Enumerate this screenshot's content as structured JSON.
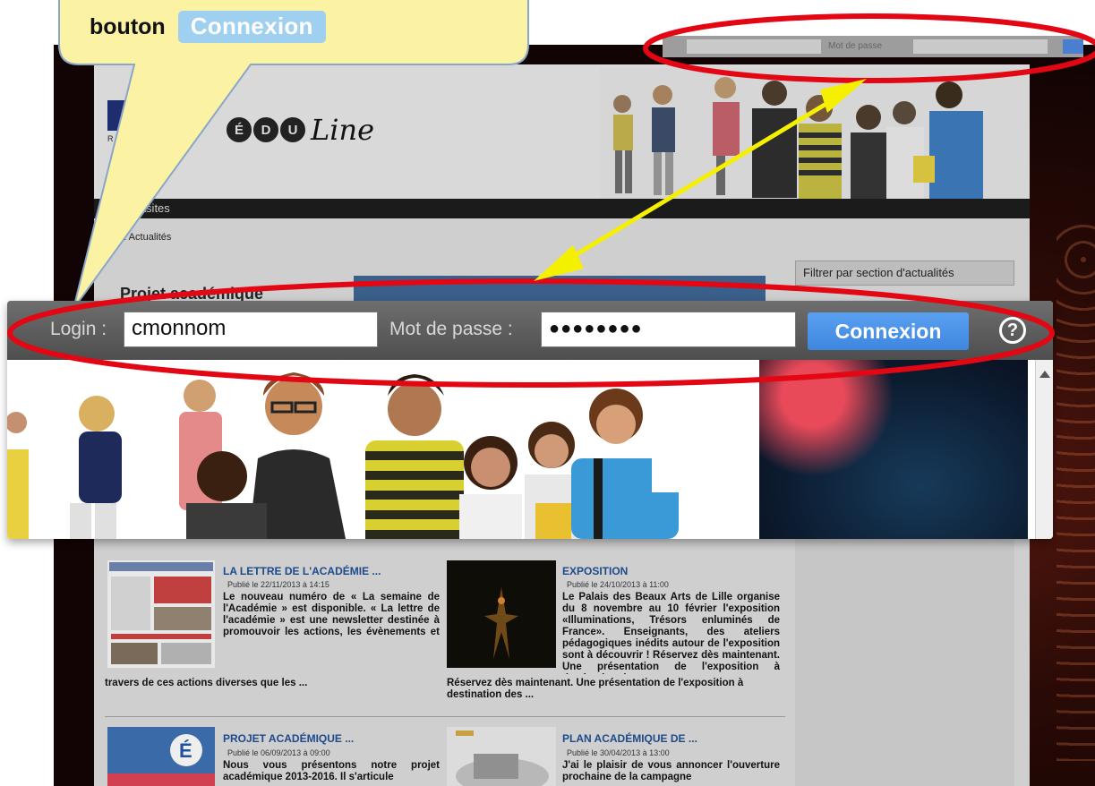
{
  "callout": {
    "word": "bouton",
    "button_chip": "Connexion"
  },
  "mini_login": {
    "password_placeholder": "Mot de passe"
  },
  "site": {
    "logo_letters": [
      "É",
      "D",
      "U"
    ],
    "logo_script": "Line",
    "nav_item": "masites",
    "breadcrumb": "line : Actualités",
    "filter_title": "Filtrer par section d'actualités",
    "featured_title": "Projet académique"
  },
  "login_bar": {
    "login_label": "Login :",
    "login_value": "cmonnom",
    "password_label": "Mot de passe :",
    "password_value": "●●●●●●●●",
    "submit_label": "Connexion",
    "help_label": "?"
  },
  "news": [
    {
      "title": "LA LETTRE DE L'ACADÉMIE ...",
      "date": "Publié le 22/11/2013 à 14:15",
      "body": "Le nouveau numéro de « La semaine de l'Académie » est disponible. « La lettre de l'académie » est une newsletter destinée à promouvoir les actions, les évènements et les projets se déroulant au sein des établissements. C'est au travers de ces actions diverses que les ..."
    },
    {
      "title": "EXPOSITION",
      "date": "Publié le 24/10/2013 à 11:00",
      "body": "Le Palais des Beaux Arts de Lille organise du 8 novembre au 10 février l'exposition «Illuminations, Trésors enluminés de France». Enseignants, des ateliers pédagogiques inédits autour de l'exposition sont à découvrir ! Réservez dès maintenant. Une présentation de l'exposition à destination des ..."
    },
    {
      "title": "PROJET ACADÉMIQUE ...",
      "date": "Publié le 06/09/2013 à 09:00",
      "body": "Nous vous présentons notre projet académique 2013-2016. Il s'articule"
    },
    {
      "title": "PLAN ACADÉMIQUE DE ...",
      "date": "Publié le 30/04/2013 à 13:00",
      "body": "J'ai le plaisir de vous annoncer l'ouverture prochaine de la campagne"
    }
  ],
  "colors": {
    "annotation_red": "#e30613",
    "arrow_yellow": "#f5f000",
    "callout_fill": "#fbf3a3",
    "button_blue": "#3f86e0"
  }
}
